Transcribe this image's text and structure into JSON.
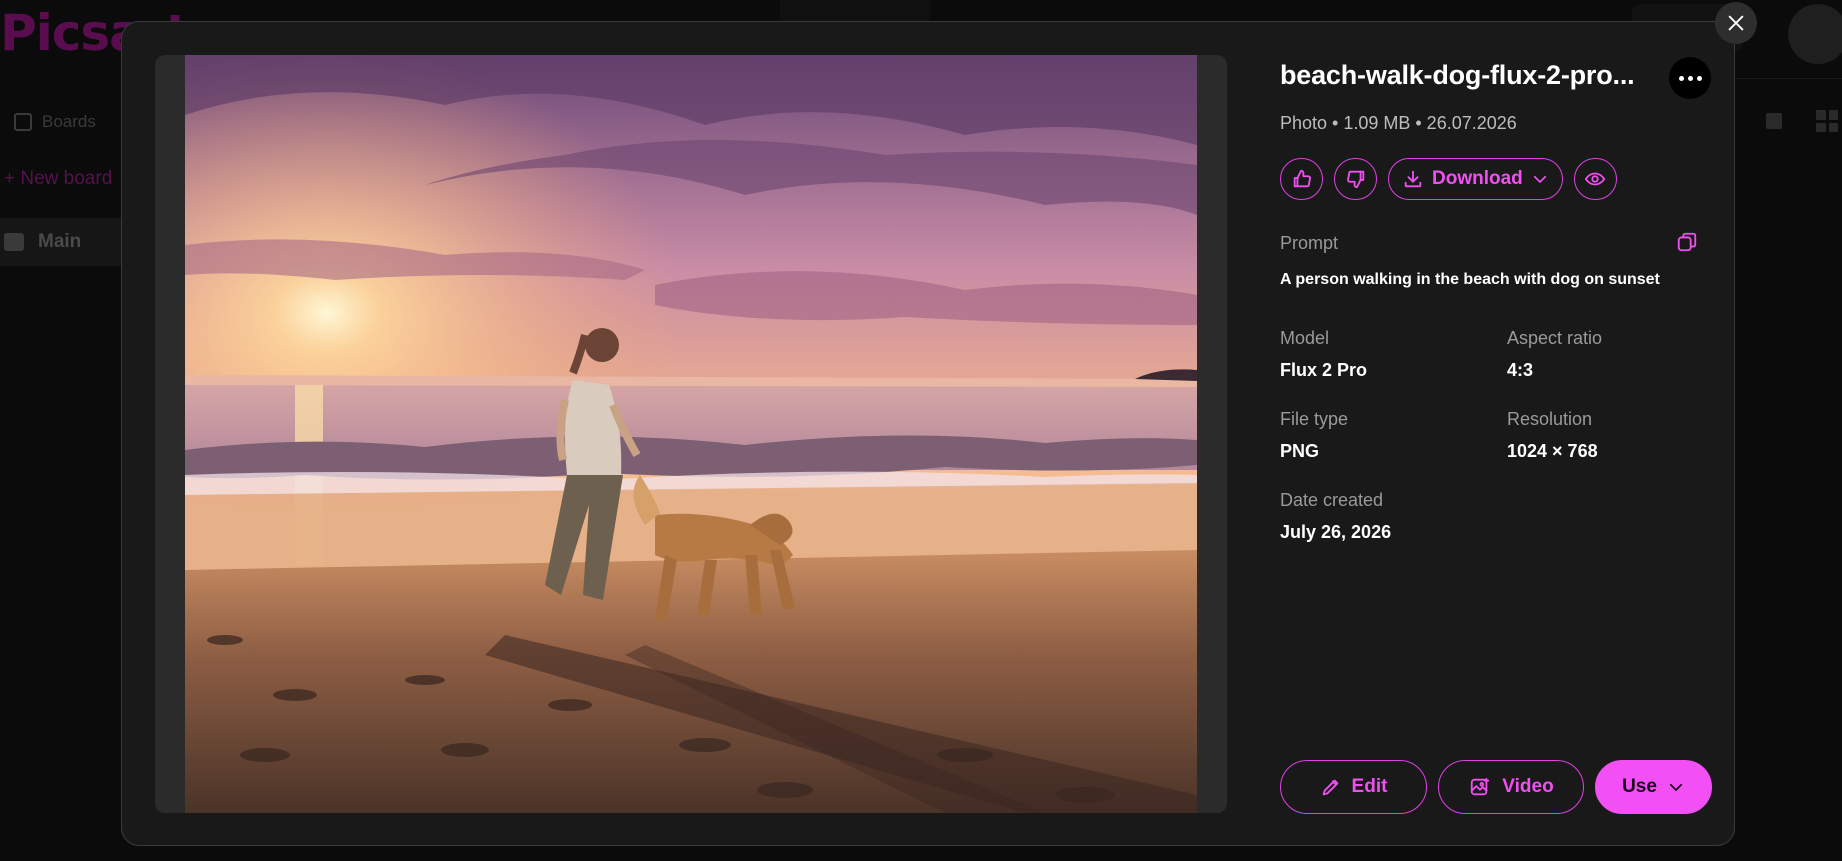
{
  "background": {
    "logo": "Picsart",
    "boards_label": "Boards",
    "new_board_label": "+ New board",
    "main_board_label": "Main"
  },
  "modal": {
    "title": "beach-walk-dog-flux-2-pro...",
    "meta": "Photo • 1.09 MB • 26.07.2026",
    "download_label": "Download",
    "prompt_label": "Prompt",
    "prompt_text": "A person walking in the beach with dog on sunset",
    "details": {
      "model_label": "Model",
      "model_value": "Flux 2 Pro",
      "aspect_label": "Aspect ratio",
      "aspect_value": "4:3",
      "filetype_label": "File type",
      "filetype_value": "PNG",
      "resolution_label": "Resolution",
      "resolution_value": "1024 × 768",
      "date_label": "Date created",
      "date_value": "July 26, 2026"
    },
    "edit_label": "Edit",
    "video_label": "Video",
    "use_label": "Use"
  },
  "colors": {
    "accent": "#f04ff2",
    "modal_bg": "#191919",
    "page_bg": "#060606"
  },
  "icons": [
    "close-icon",
    "more-icon",
    "thumbs-up-icon",
    "thumbs-down-icon",
    "download-icon",
    "chevron-down-icon",
    "eye-icon",
    "copy-icon",
    "pencil-icon",
    "video-icon"
  ]
}
